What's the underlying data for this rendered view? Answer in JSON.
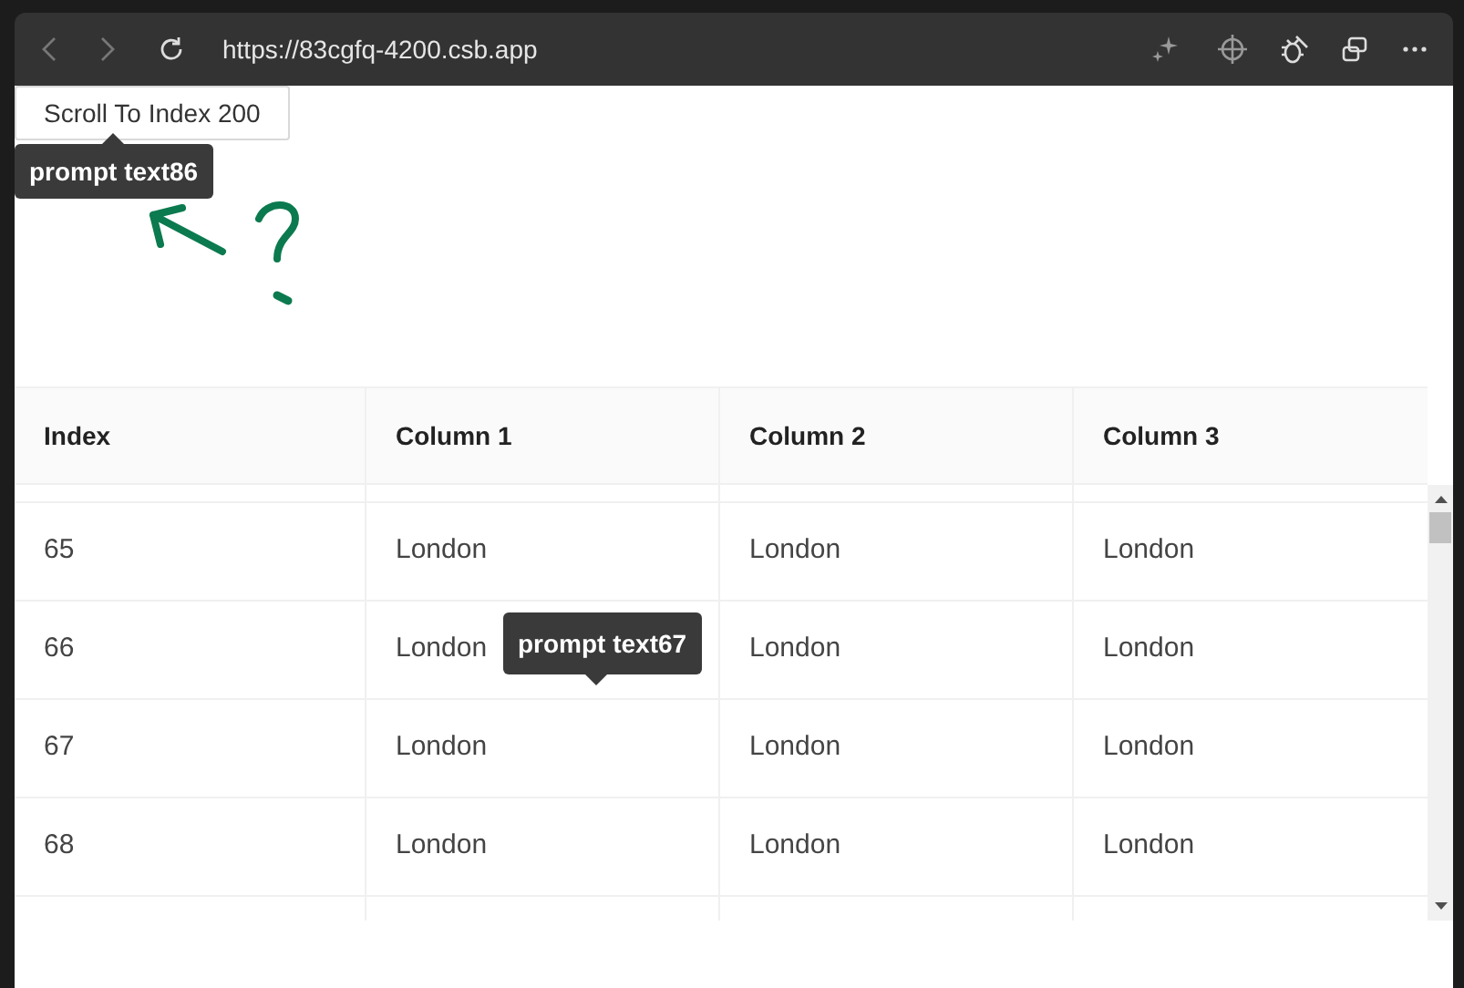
{
  "browser": {
    "url": "https://83cgfq-4200.csb.app"
  },
  "scroll_button": {
    "label": "Scroll To Index 200"
  },
  "tooltips": [
    {
      "text": "prompt text86"
    },
    {
      "text": "prompt text67"
    }
  ],
  "table": {
    "columns": [
      "Index",
      "Column 1",
      "Column 2",
      "Column 3"
    ],
    "rows": [
      {
        "cells": [
          "65",
          "London",
          "London",
          "London"
        ]
      },
      {
        "cells": [
          "66",
          "London",
          "London",
          "London"
        ]
      },
      {
        "cells": [
          "67",
          "London",
          "London",
          "London"
        ]
      },
      {
        "cells": [
          "68",
          "London",
          "London",
          "London"
        ]
      }
    ]
  }
}
